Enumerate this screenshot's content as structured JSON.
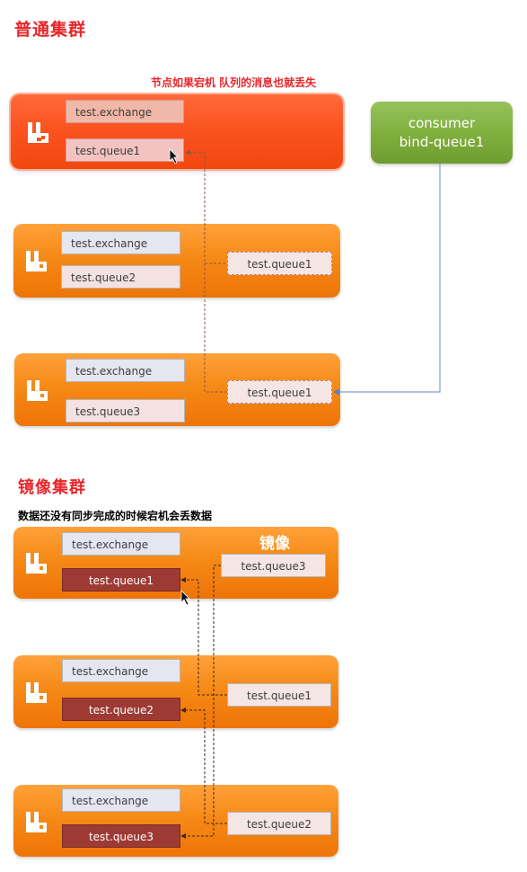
{
  "normal_cluster": {
    "title": "普通集群",
    "note": "节点如果宕机 队列的消息也就丢失",
    "nodes": [
      {
        "exchange": "test.exchange",
        "queue": "test.queue1"
      },
      {
        "exchange": "test.exchange",
        "queue": "test.queue2",
        "replica": "test.queue1"
      },
      {
        "exchange": "test.exchange",
        "queue": "test.queue3",
        "replica": "test.queue1"
      }
    ],
    "consumer": {
      "line1": "consumer",
      "line2": "bind-queue1"
    }
  },
  "mirror_cluster": {
    "title": "镜像集群",
    "note": "数据还没有同步完成的时候宕机会丢数据",
    "mirror_label": "镜像",
    "nodes": [
      {
        "exchange": "test.exchange",
        "queue": "test.queue1",
        "replica": "test.queue3"
      },
      {
        "exchange": "test.exchange",
        "queue": "test.queue2",
        "replica": "test.queue1"
      },
      {
        "exchange": "test.exchange",
        "queue": "test.queue3",
        "replica": "test.queue2"
      }
    ]
  },
  "colors": {
    "title": "#e8262a",
    "node_orange": "#f68a16",
    "node_down": "#fb5421",
    "consumer_green": "#7fae3d",
    "mirror_queue": "#9e3a34"
  }
}
